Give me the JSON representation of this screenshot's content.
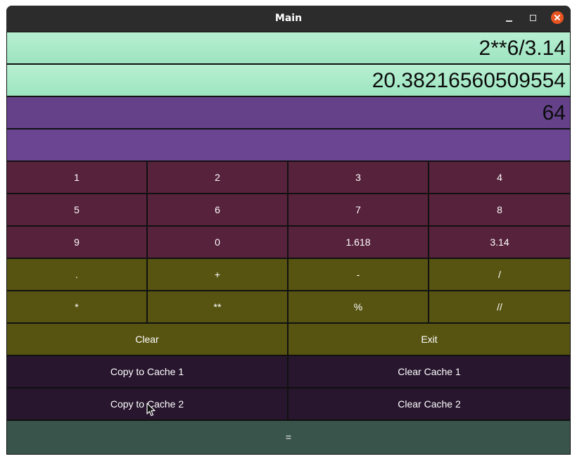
{
  "window": {
    "title": "Main"
  },
  "displays": {
    "expression": "2**6/3.14",
    "result": "20.38216560509554",
    "cache1": "64",
    "cache2": ""
  },
  "keypad": {
    "row1": [
      "1",
      "2",
      "3",
      "4"
    ],
    "row2": [
      "5",
      "6",
      "7",
      "8"
    ],
    "row3": [
      "9",
      "0",
      "1.618",
      "3.14"
    ],
    "row4": [
      ".",
      "+",
      "-",
      "/"
    ],
    "row5": [
      "*",
      "**",
      "%",
      "//"
    ]
  },
  "actions": {
    "clear": "Clear",
    "exit": "Exit",
    "copy_cache1": "Copy to Cache 1",
    "clear_cache1": "Clear Cache 1",
    "copy_cache2": "Copy to Cache 2",
    "clear_cache2": "Clear Cache 2",
    "equals": "="
  },
  "colors": {
    "display_green": "#a3e8c6",
    "display_purple": "#65418a",
    "digit_buttons": "#57223b",
    "operator_buttons": "#575412",
    "cache_buttons": "#27162d",
    "equals_button": "#39544a",
    "close_button": "#e95420"
  }
}
